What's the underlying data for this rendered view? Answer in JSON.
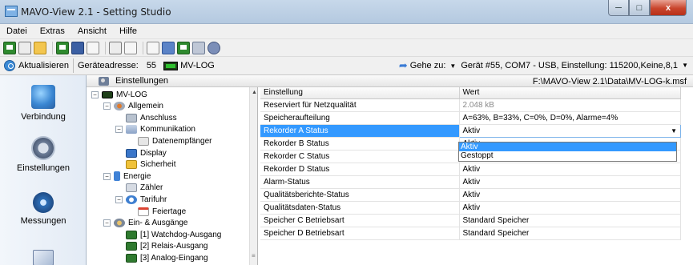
{
  "window": {
    "title": "MAVO-View 2.1 - Setting Studio",
    "minimize_glyph": "─",
    "maximize_glyph": "□",
    "close_glyph": "x"
  },
  "menu": [
    "Datei",
    "Extras",
    "Ansicht",
    "Hilfe"
  ],
  "address_bar": {
    "refresh_label": "Aktualisieren",
    "address_label": "Geräteadresse:",
    "address_value": "55",
    "device_name": "MV-LOG",
    "goto_label": "Gehe zu:",
    "connection": "Gerät #55, COM7 - USB, Einstellung: 115200,Keine,8,1"
  },
  "nav": [
    {
      "label": "Verbindung",
      "icon": "connection-icon"
    },
    {
      "label": "Einstellungen",
      "icon": "settings-icon"
    },
    {
      "label": "Messungen",
      "icon": "measurements-icon"
    }
  ],
  "header": {
    "title": "Einstellungen",
    "file_path": "F:\\MAVO-View 2.1\\Data\\MV-LOG-k.msf"
  },
  "tree": [
    {
      "label": "MV-LOG",
      "depth": 0,
      "expander": "−",
      "icon": "device-icon"
    },
    {
      "label": "Allgemein",
      "depth": 1,
      "expander": "−",
      "icon": "general-icon"
    },
    {
      "label": "Anschluss",
      "depth": 2,
      "expander": "",
      "icon": "plug-icon"
    },
    {
      "label": "Kommunikation",
      "depth": 2,
      "expander": "−",
      "icon": "communication-icon"
    },
    {
      "label": "Datenempfänger",
      "depth": 3,
      "expander": "",
      "icon": "receiver-icon"
    },
    {
      "label": "Display",
      "depth": 2,
      "expander": "",
      "icon": "display-icon"
    },
    {
      "label": "Sicherheit",
      "depth": 2,
      "expander": "",
      "icon": "lock-icon"
    },
    {
      "label": "Energie",
      "depth": 1,
      "expander": "−",
      "icon": "energy-icon"
    },
    {
      "label": "Zähler",
      "depth": 2,
      "expander": "",
      "icon": "counter-icon"
    },
    {
      "label": "Tarifuhr",
      "depth": 2,
      "expander": "−",
      "icon": "tariff-clock-icon"
    },
    {
      "label": "Feiertage",
      "depth": 3,
      "expander": "",
      "icon": "calendar-icon"
    },
    {
      "label": "Ein- & Ausgänge",
      "depth": 1,
      "expander": "−",
      "icon": "io-icon"
    },
    {
      "label": "[1] Watchdog-Ausgang",
      "depth": 2,
      "expander": "",
      "icon": "output-icon"
    },
    {
      "label": "[2] Relais-Ausgang",
      "depth": 2,
      "expander": "",
      "icon": "output-icon"
    },
    {
      "label": "[3] Analog-Eingang",
      "depth": 2,
      "expander": "",
      "icon": "output-icon"
    }
  ],
  "grid": {
    "columns": [
      "Einstellung",
      "Wert"
    ],
    "rows": [
      {
        "name": "Reserviert für Netzqualität",
        "value": "2.048 kB"
      },
      {
        "name": "Speicheraufteilung",
        "value": "A=63%, B=33%, C=0%, D=0%, Alarme=4%"
      },
      {
        "name": "Rekorder A Status",
        "value": "Aktiv"
      },
      {
        "name": "Rekorder B Status",
        "value": "Aktiv"
      },
      {
        "name": "Rekorder C Status",
        "value": "Aktiv"
      },
      {
        "name": "Rekorder D Status",
        "value": "Aktiv"
      },
      {
        "name": "Alarm-Status",
        "value": "Aktiv"
      },
      {
        "name": "Qualitätsberichte-Status",
        "value": "Aktiv"
      },
      {
        "name": "Qualitätsdaten-Status",
        "value": "Aktiv"
      },
      {
        "name": "Speicher C Betriebsart",
        "value": "Standard Speicher"
      },
      {
        "name": "Speicher D Betriebsart",
        "value": "Standard Speicher"
      }
    ],
    "selected_row": 2,
    "dropdown_options": [
      "Aktiv",
      "Gestoppt"
    ]
  }
}
